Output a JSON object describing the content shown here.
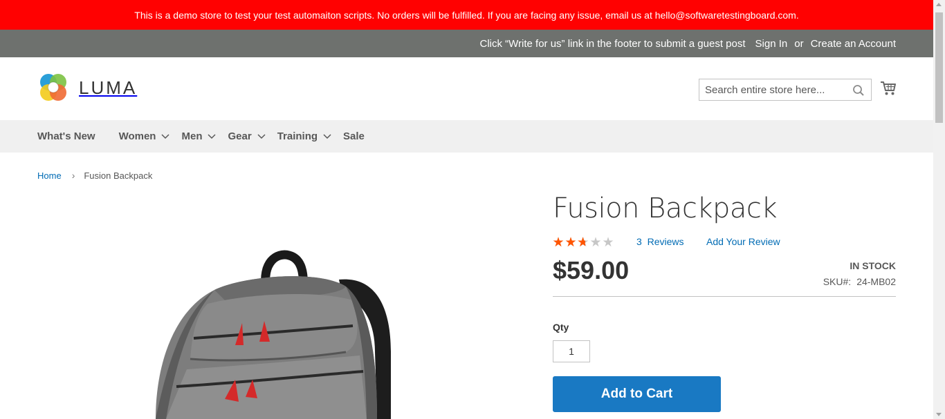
{
  "demo_notice": "This is a demo store to test your test automaiton scripts. No orders will be fulfilled. If you are facing any issue, email us at hello@softwaretestingboard.com.",
  "panel": {
    "guest_post_text": "Click “Write for us” link in the footer to submit a guest post",
    "sign_in": "Sign In",
    "or": "or",
    "create_account": "Create an Account"
  },
  "header": {
    "logo_text": "LUMA",
    "search_placeholder": "Search entire store here...",
    "search_icon": "search-icon",
    "cart_icon": "cart-icon"
  },
  "nav": {
    "items": [
      {
        "label": "What's New",
        "has_dropdown": false
      },
      {
        "label": "Women",
        "has_dropdown": true
      },
      {
        "label": "Men",
        "has_dropdown": true
      },
      {
        "label": "Gear",
        "has_dropdown": true
      },
      {
        "label": "Training",
        "has_dropdown": true
      },
      {
        "label": "Sale",
        "has_dropdown": false
      }
    ]
  },
  "breadcrumb": {
    "home": "Home",
    "current": "Fusion Backpack"
  },
  "product": {
    "title": "Fusion Backpack",
    "rating_out_of_5": 2.67,
    "reviews_count": "3",
    "reviews_label": "Reviews",
    "add_review": "Add Your Review",
    "price": "$59.00",
    "stock": "IN STOCK",
    "sku_label": "SKU#:",
    "sku": "24-MB02",
    "qty_label": "Qty",
    "qty_value": "1",
    "add_to_cart": "Add to Cart"
  },
  "colors": {
    "demo_bar": "#ff0101",
    "panel": "#6e716e",
    "link": "#006bb4",
    "button": "#1979c3",
    "star_filled": "#ff5501",
    "star_empty": "#c7c7c7"
  }
}
